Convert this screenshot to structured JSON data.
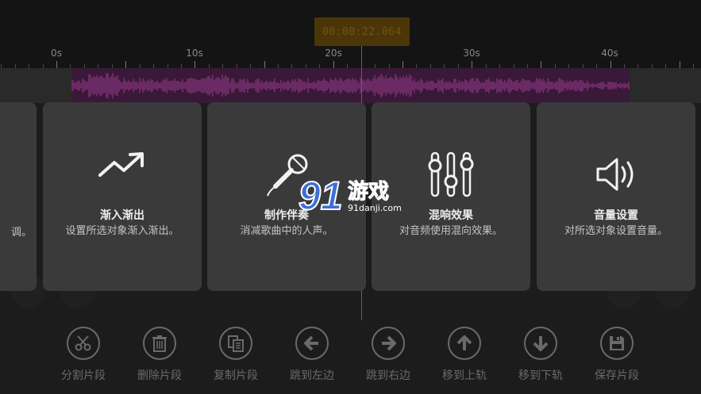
{
  "timer": {
    "value": "00:00:22.064"
  },
  "ruler": {
    "labels": [
      "0s",
      "10s",
      "20s",
      "30s",
      "40s"
    ]
  },
  "cards": [
    {
      "title": "渐入渐出",
      "desc": "设置所选对象渐入渐出。",
      "icon": "trend-up-icon"
    },
    {
      "title": "制作伴奏",
      "desc": "消减歌曲中的人声。",
      "icon": "microphone-icon"
    },
    {
      "title": "混响效果",
      "desc": "对音频使用混向效果。",
      "icon": "equalizer-sliders-icon"
    },
    {
      "title": "音量设置",
      "desc": "对所选对象设置音量。",
      "icon": "speaker-icon"
    }
  ],
  "partial_card": {
    "text": "调。"
  },
  "watermark": {
    "number": "91",
    "name": "游戏",
    "url": "91danji.com"
  },
  "toolbar": {
    "items": [
      {
        "label": "分割片段",
        "icon": "scissors-icon"
      },
      {
        "label": "删除片段",
        "icon": "trash-icon"
      },
      {
        "label": "复制片段",
        "icon": "copy-icon"
      },
      {
        "label": "跳到左边",
        "icon": "arrow-left-icon"
      },
      {
        "label": "跳到右边",
        "icon": "arrow-right-icon"
      },
      {
        "label": "移到上轨",
        "icon": "arrow-up-icon"
      },
      {
        "label": "移到下轨",
        "icon": "arrow-down-icon"
      },
      {
        "label": "保存片段",
        "icon": "save-icon"
      }
    ]
  },
  "colors": {
    "accent": "#8a6010",
    "waveform": "#7a3072",
    "card": "#3a3a3a",
    "toolbar_text": "#6a6a6a"
  }
}
